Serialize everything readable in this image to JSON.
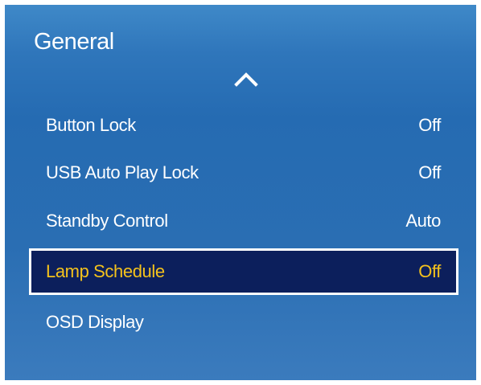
{
  "panel": {
    "title": "General"
  },
  "icons": {
    "scroll_up": "chevron-up-icon"
  },
  "menu": {
    "items": [
      {
        "label": "Button Lock",
        "value": "Off"
      },
      {
        "label": "USB Auto Play Lock",
        "value": "Off"
      },
      {
        "label": "Standby Control",
        "value": "Auto"
      },
      {
        "label": "Lamp Schedule",
        "value": "Off",
        "selected": true
      },
      {
        "label": "OSD Display",
        "value": ""
      }
    ]
  },
  "colors": {
    "panel_blue": "#2a6eb3",
    "selected_background": "#0c1f5c",
    "selected_text": "#f4c21c",
    "text": "#ffffff"
  }
}
